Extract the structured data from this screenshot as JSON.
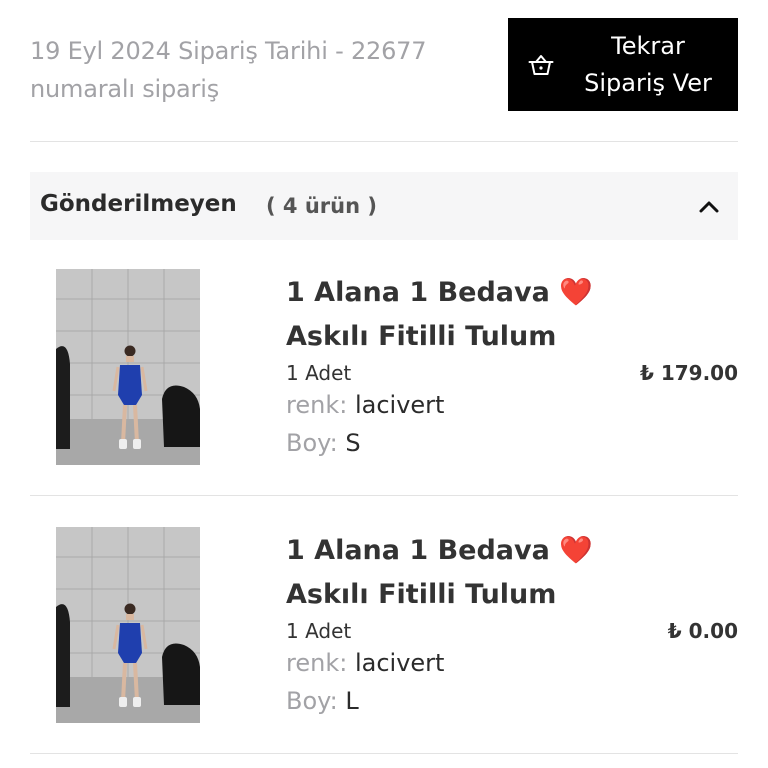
{
  "order": {
    "meta_line1": "19 Eyl 2024 Sipariş Tarihi - 22677",
    "meta_line2": "numaralı sipariş",
    "reorder_line1": "Tekrar",
    "reorder_line2": "Sipariş Ver",
    "reorder_icon": "basket-icon"
  },
  "group": {
    "title": "Gönderilmeyen",
    "count": "( 4 ürün )",
    "toggle_icon": "chevron-up-icon"
  },
  "items": [
    {
      "title_line1": "1 Alana 1 Bedava",
      "heart": "❤️",
      "title_line2": "Askılı Fitilli Tulum",
      "qty": "1 Adet",
      "price": "₺ 179.00",
      "renk_label": "renk:",
      "renk_value": "lacivert",
      "boy_label": "Boy:",
      "boy_value": "S"
    },
    {
      "title_line1": "1 Alana 1 Bedava",
      "heart": "❤️",
      "title_line2": "Askılı Fitilli Tulum",
      "qty": "1 Adet",
      "price": "₺ 0.00",
      "renk_label": "renk:",
      "renk_value": "lacivert",
      "boy_label": "Boy:",
      "boy_value": "L"
    }
  ],
  "colors": {
    "button_bg": "#000000",
    "muted_text": "#a2a2a6",
    "group_bg": "#f6f6f7",
    "heart": "#e51e2c",
    "garment": "#1f3fae"
  }
}
